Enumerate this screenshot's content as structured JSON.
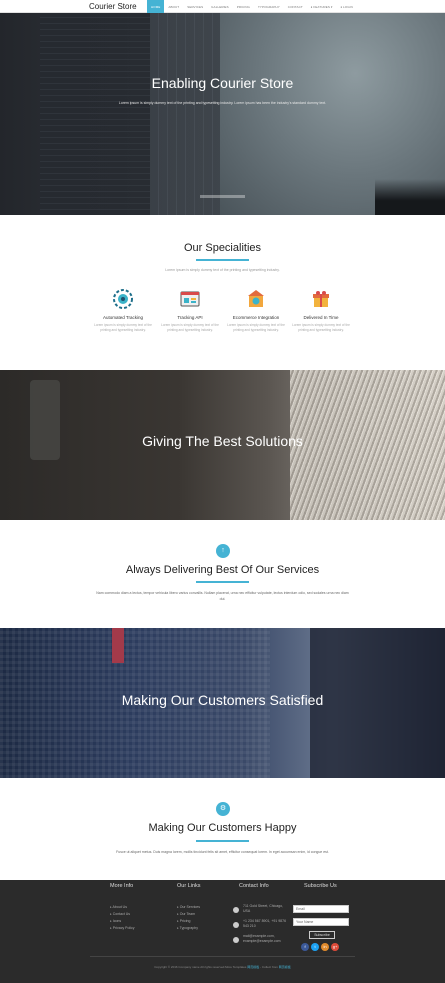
{
  "nav": {
    "brand": "Courier Store",
    "items": [
      "HOME",
      "ABOUT",
      "SERVICES",
      "GALLERIES",
      "PRICING",
      "TYPOGRAPHY",
      "CONTACT",
      "♦ FEATURES ▾",
      "♦ LOGIN"
    ]
  },
  "hero": {
    "title": "Enabling Courier Store",
    "subtitle": "Lorem ipsum is simply dummy text of the printing and typesetting industry. Lorem ipsum has been the industry's standard dummy text."
  },
  "specialities": {
    "title": "Our Specialities",
    "subtitle": "Lorem ipsum is simply dummy text of the printing and typesetting industry.",
    "items": [
      {
        "title": "Automated Tracking",
        "desc": "Lorem ipsum is simply dummy text of the printing and typesetting industry.",
        "icon": "gear-globe-icon"
      },
      {
        "title": "Tracking API",
        "desc": "Lorem ipsum is simply dummy text of the printing and typesetting industry.",
        "icon": "browser-window-icon"
      },
      {
        "title": "Ecommerce Integration",
        "desc": "Lorem ipsum is simply dummy text of the printing and typesetting industry.",
        "icon": "shop-dollar-icon"
      },
      {
        "title": "Delivered In Time",
        "desc": "Lorem ipsum is simply dummy text of the printing and typesetting industry.",
        "icon": "gift-box-icon"
      }
    ]
  },
  "band1": {
    "title": "Giving The Best Solutions"
  },
  "delivering": {
    "title": "Always Delivering Best Of Our Services",
    "text": "Nam commodo diam a lectus, tempor vehicula libero varius convallis. Nullam placerat, urna nec efficitur vulputate, lectus interdum odio, sed sodales urna nec diam dui."
  },
  "band2": {
    "title": "Making Our Customers Satisfied"
  },
  "happy": {
    "title": "Making Our Customers Happy",
    "text": "Fusce ut aliquet metus. Duis magna lorem, mollis tincidunt felis sit amet, efficitur consequat lorem. In eget accumsan enim, id congue est."
  },
  "footer": {
    "more_info": {
      "title": "More Info",
      "links": [
        "About Us",
        "Contact Us",
        "Icons",
        "Privacy Policy"
      ]
    },
    "our_links": {
      "title": "Our Links",
      "links": [
        "Our Services",
        "Our Team",
        "Pricing",
        "Typography"
      ]
    },
    "contact": {
      "title": "Contact Info",
      "address": "711 Gold Street, Chicago, USA",
      "phone": "+1 234 567 8901, +91 9876 543 210",
      "email": "mail@example.com, example@example.com"
    },
    "subscribe": {
      "title": "Subscribe Us",
      "email_placeholder": "Email",
      "name_placeholder": "Your Name",
      "button": "Subscribe"
    },
    "social": [
      "f",
      "t",
      "in",
      "g+"
    ],
    "copyright_prefix": "Copyright © 2016 Company name All rights reserved.More Templates ",
    "copyright_link1": "网页模板",
    "copyright_mid": " - Collect from ",
    "copyright_link2": "网页模板"
  },
  "colors": {
    "accent": "#45b3d4",
    "footer_bg": "#2b2b2b"
  }
}
